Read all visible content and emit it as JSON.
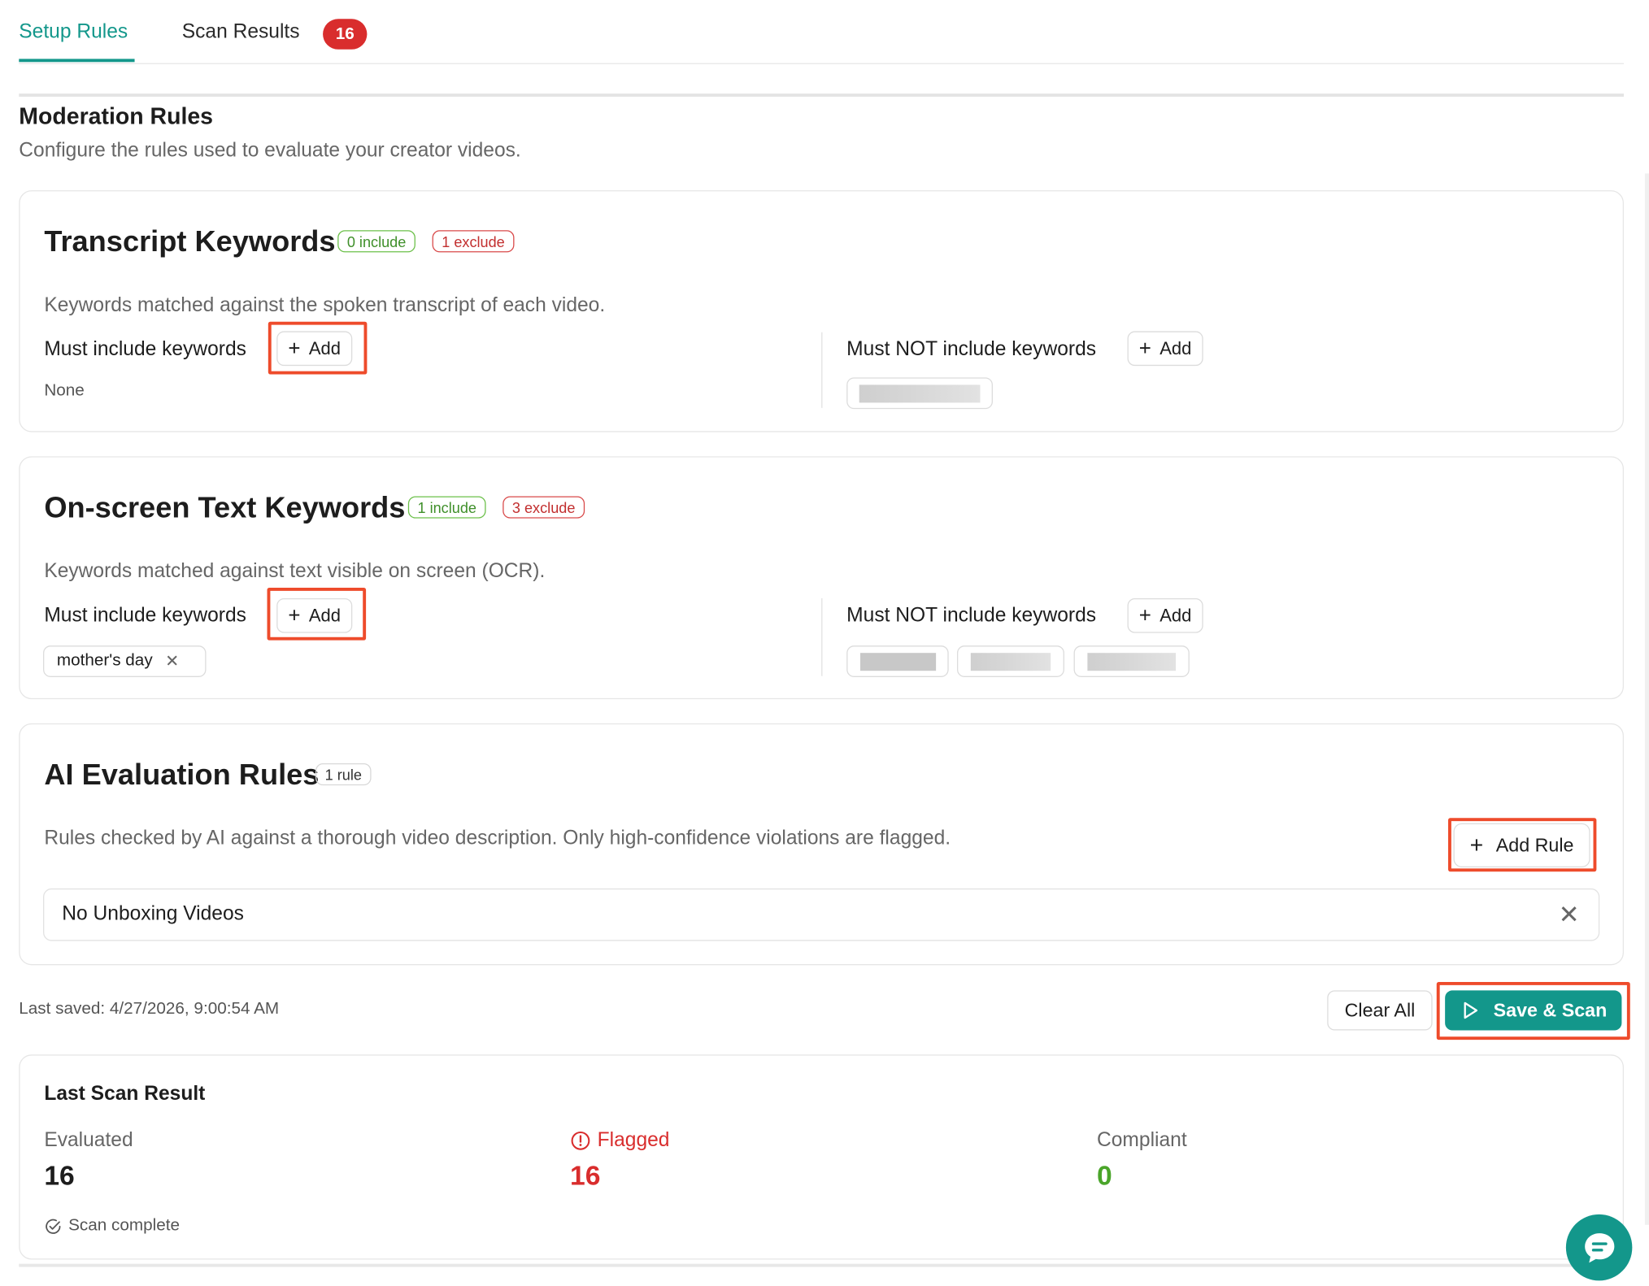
{
  "tabs": {
    "setup": "Setup Rules",
    "results": "Scan Results",
    "results_badge": "16"
  },
  "header": {
    "title": "Moderation Rules",
    "subtitle": "Configure the rules used to evaluate your creator videos."
  },
  "transcript": {
    "title": "Transcript Keywords",
    "include_pill": "0 include",
    "exclude_pill": "1 exclude",
    "description": "Keywords matched against the spoken transcript of each video.",
    "must_include_label": "Must include keywords",
    "must_not_label": "Must NOT include keywords",
    "add_label": "Add",
    "none_text": "None"
  },
  "onscreen": {
    "title": "On-screen Text Keywords",
    "include_pill": "1 include",
    "exclude_pill": "3 exclude",
    "description": "Keywords matched against text visible on screen (OCR).",
    "must_include_label": "Must include keywords",
    "must_not_label": "Must NOT include keywords",
    "add_label": "Add",
    "include_keywords": [
      "mother's day"
    ]
  },
  "ai_rules": {
    "title": "AI Evaluation Rules",
    "count_pill": "1 rule",
    "description": "Rules checked by AI against a thorough video description. Only high-confidence violations are flagged.",
    "add_rule_label": "Add Rule",
    "rules": [
      "No Unboxing Videos"
    ]
  },
  "footer": {
    "last_saved": "Last saved: 4/27/2026, 9:00:54 AM",
    "clear_all": "Clear All",
    "save_scan": "Save & Scan"
  },
  "last_scan": {
    "title": "Last Scan Result",
    "evaluated_label": "Evaluated",
    "evaluated_value": "16",
    "flagged_label": "Flagged",
    "flagged_value": "16",
    "compliant_label": "Compliant",
    "compliant_value": "0",
    "status": "Scan complete"
  },
  "colors": {
    "accent": "#13978b",
    "danger": "#d92d2d",
    "success": "#4aa52a",
    "highlight": "#ee4b2b"
  },
  "icons": {
    "add": "plus-icon",
    "remove": "close-icon",
    "play": "play-icon",
    "flagged": "alert-circle-icon",
    "complete": "check-circle-icon",
    "chat": "chat-bubble-icon"
  }
}
